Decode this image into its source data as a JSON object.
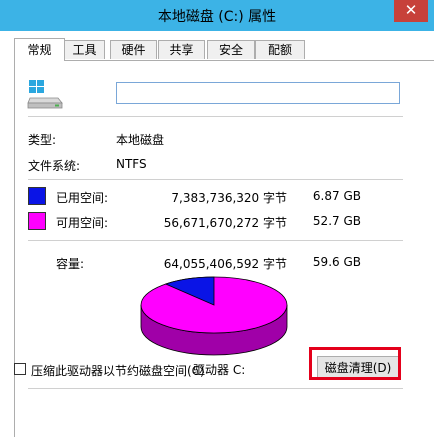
{
  "window": {
    "title": "本地磁盘 (C:) 属性",
    "close_glyph": "✕"
  },
  "tabs": [
    {
      "label": "常规",
      "active": true
    },
    {
      "label": "工具",
      "active": false
    },
    {
      "label": "硬件",
      "active": false
    },
    {
      "label": "共享",
      "active": false
    },
    {
      "label": "安全",
      "active": false
    },
    {
      "label": "配额",
      "active": false
    }
  ],
  "general": {
    "name_value": "",
    "type_label": "类型:",
    "type_value": "本地磁盘",
    "fs_label": "文件系统:",
    "fs_value": "NTFS",
    "used_label": "已用空间:",
    "used_bytes": "7,383,736,320 字节",
    "used_gb": "6.87 GB",
    "free_label": "可用空间:",
    "free_bytes": "56,671,670,272 字节",
    "free_gb": "52.7 GB",
    "capacity_label": "容量:",
    "capacity_bytes": "64,055,406,592 字节",
    "capacity_gb": "59.6 GB",
    "drive_label": "驱动器 C:",
    "cleanup_button": "磁盘清理(D)",
    "compress_label": "压缩此驱动器以节约磁盘空间(C)"
  },
  "colors": {
    "used": "#0a14e6",
    "free": "#ff00ff",
    "highlight": "#e4001b",
    "titlebar": "#3cb3e6"
  },
  "usage": {
    "used_fraction": 0.115
  }
}
